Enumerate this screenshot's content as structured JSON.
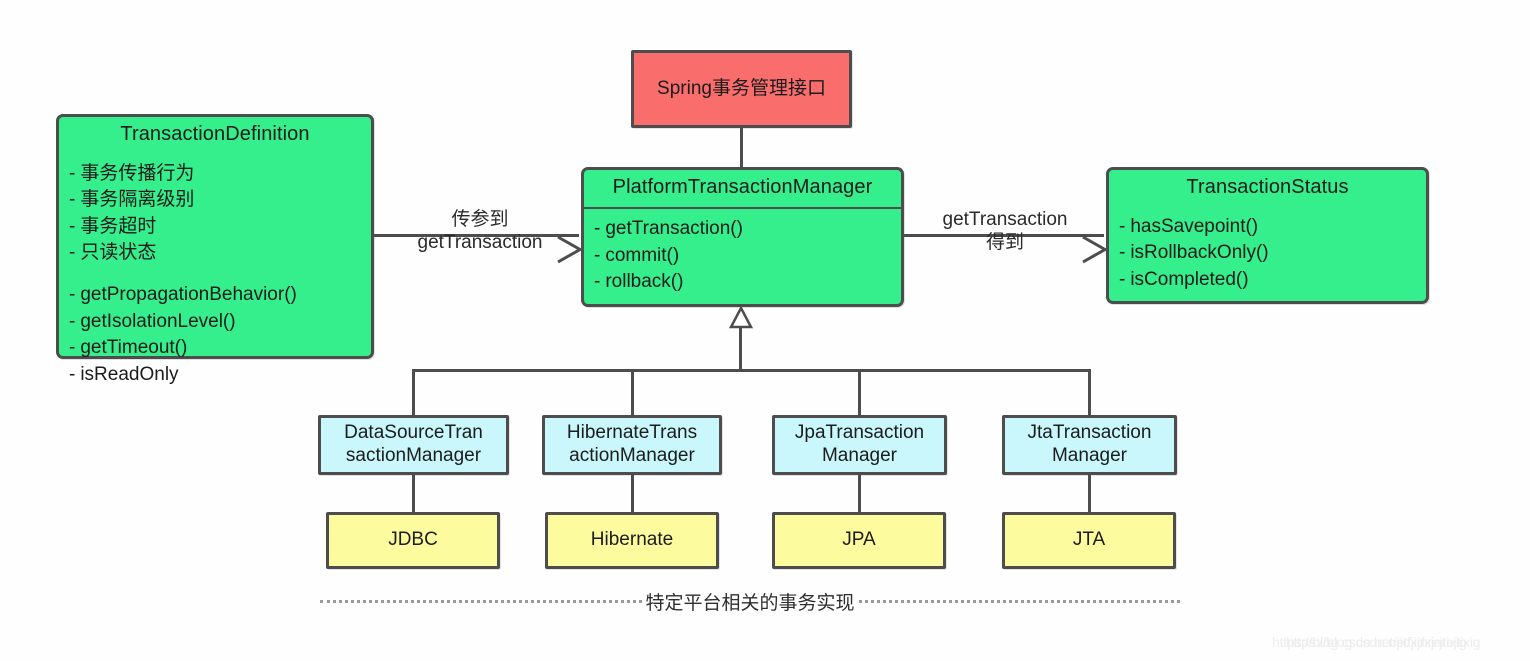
{
  "diagram": {
    "title_concept": "Spring事务管理接口",
    "spring_interface": {
      "label": "Spring事务管理接口",
      "color": "#fa6d6d"
    },
    "transaction_definition": {
      "title": "TransactionDefinition",
      "color": "#35ee8c",
      "attributes": [
        "事务传播行为",
        "事务隔离级别",
        "事务超时",
        "只读状态"
      ],
      "methods": [
        "getPropagationBehavior()",
        "getIsolationLevel()",
        "getTimeout()",
        "isReadOnly"
      ]
    },
    "platform_transaction_manager": {
      "title": "PlatformTransactionManager",
      "color": "#35ee8c",
      "methods": [
        "getTransaction()",
        "commit()",
        "rollback()"
      ]
    },
    "transaction_status": {
      "title": "TransactionStatus",
      "color": "#35ee8c",
      "methods": [
        "hasSavepoint()",
        "isRollbackOnly()",
        "isCompleted()"
      ]
    },
    "edge_labels": {
      "left": {
        "line1": "传参到",
        "line2": "getTransaction"
      },
      "right": {
        "line1": "getTransaction",
        "line2": "得到"
      }
    },
    "implementations": [
      {
        "manager_line1": "DataSourceTran",
        "manager_line2": "sactionManager",
        "platform": "JDBC"
      },
      {
        "manager_line1": "HibernateTrans",
        "manager_line2": "actionManager",
        "platform": "Hibernate"
      },
      {
        "manager_line1": "JpaTransaction",
        "manager_line2": "Manager",
        "platform": "JPA"
      },
      {
        "manager_line1": "JtaTransaction",
        "manager_line2": "Manager",
        "platform": "JTA"
      }
    ],
    "footer_note": "特定平台相关的事务实现",
    "watermark": "https://blog.csdn.net/jidxjnrejtixig",
    "colors": {
      "green": "#35ee8c",
      "red": "#fa6d6d",
      "cyan": "#c9f7fb",
      "yellow": "#fcfc9e",
      "stroke": "#4d4d4d"
    }
  }
}
